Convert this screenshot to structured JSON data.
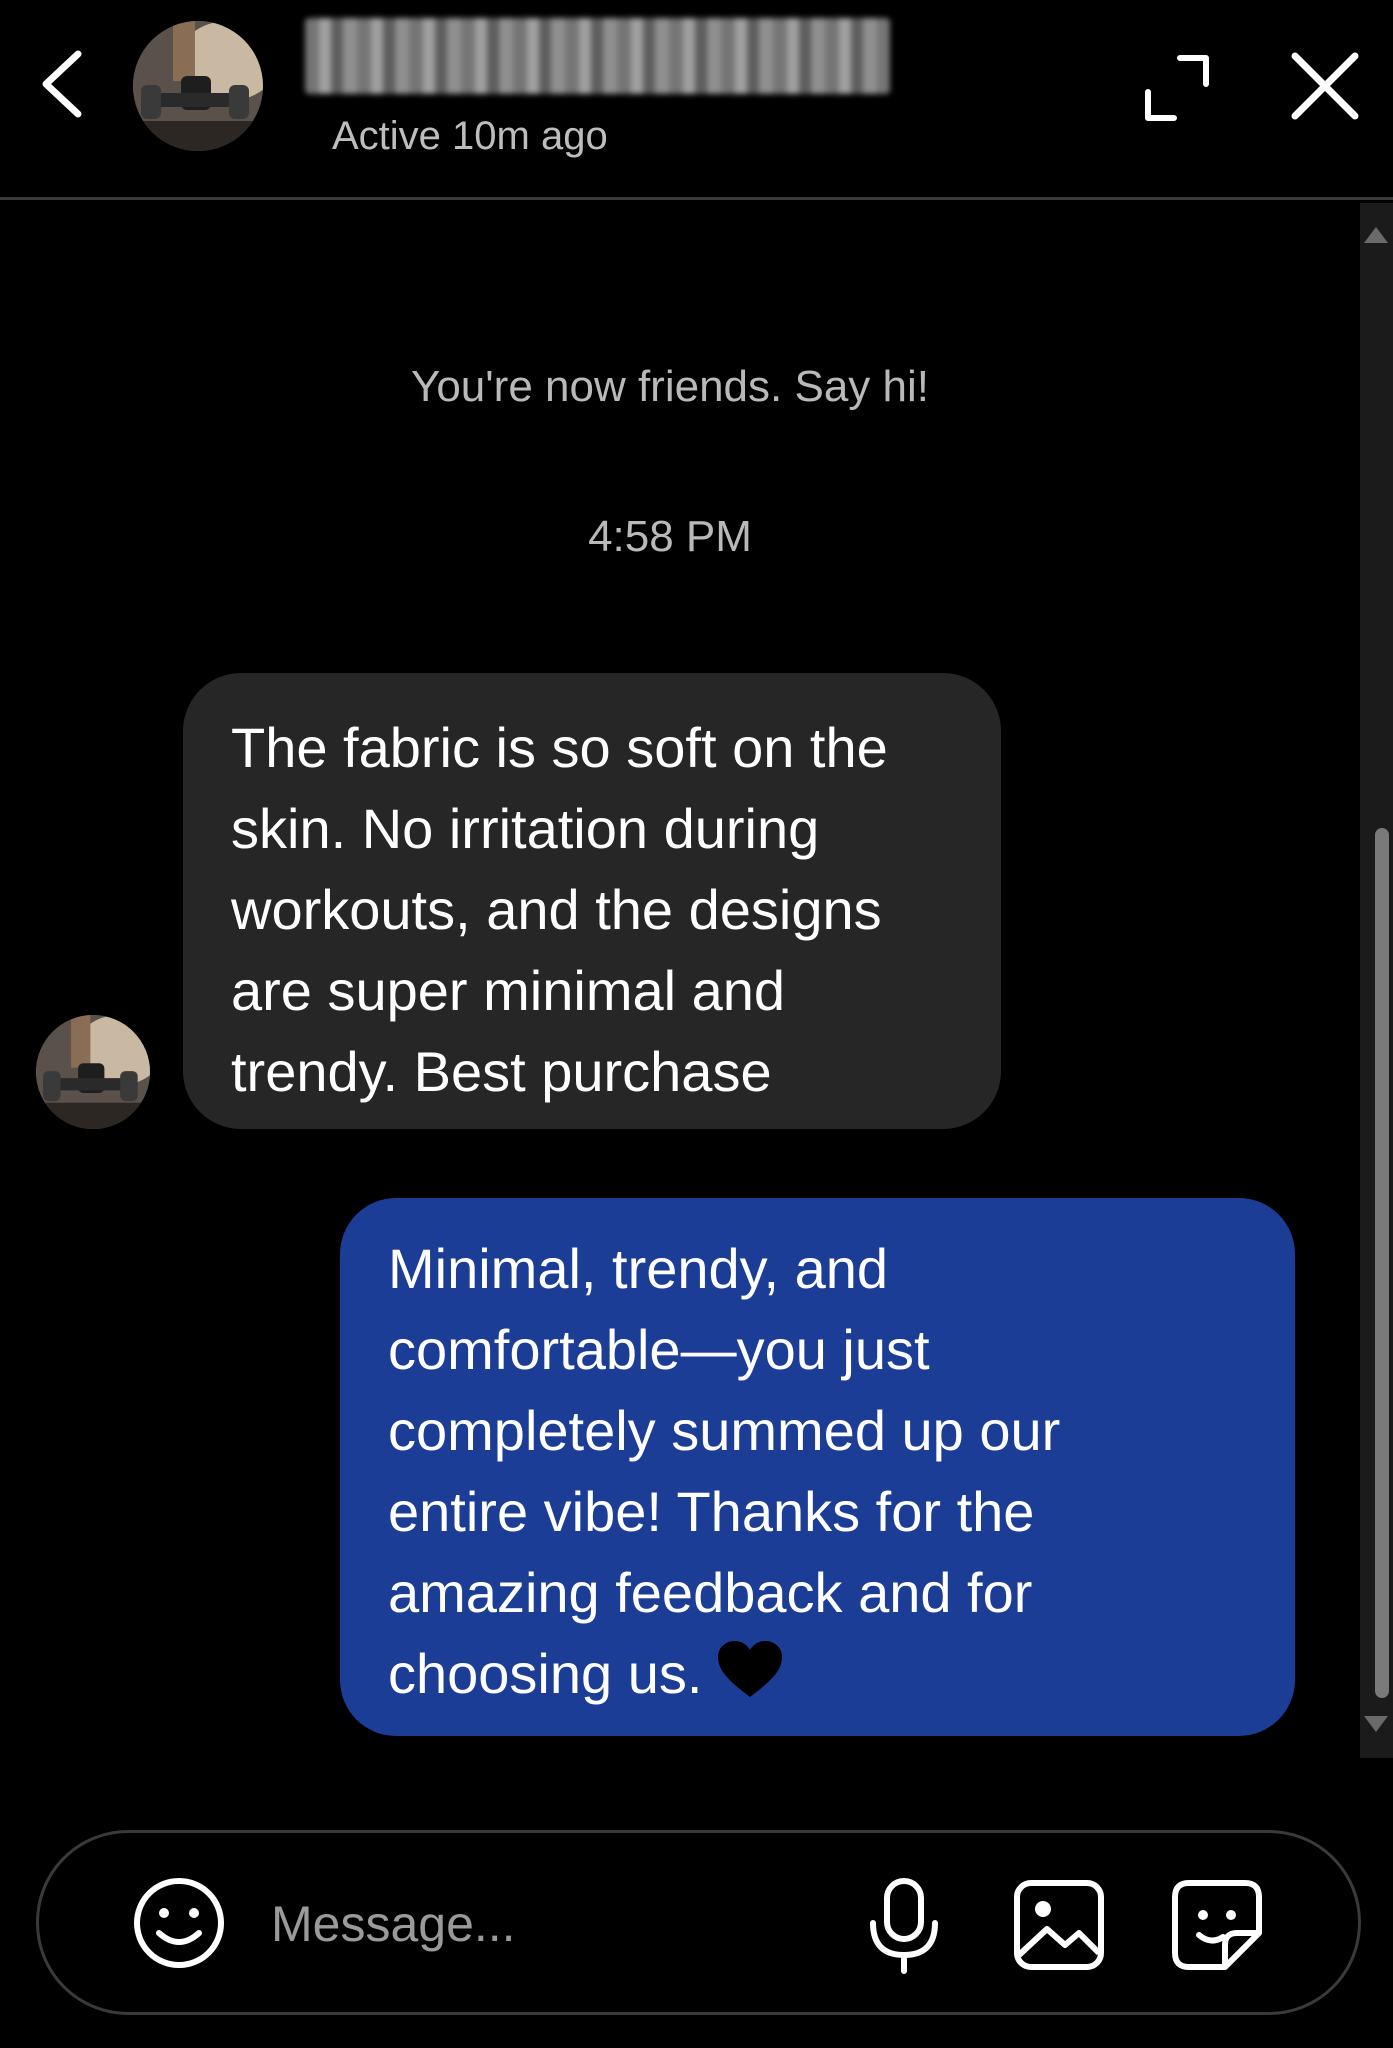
{
  "header": {
    "active_status": "Active 10m ago"
  },
  "conversation": {
    "system_message": "You're now friends. Say hi!",
    "timestamp": "4:58 PM",
    "incoming_message": "The fabric is so soft on the\nskin. No irritation during\nworkouts, and the designs\nare super minimal and\ntrendy. Best purchase",
    "outgoing_message": "Minimal, trendy, and\ncomfortable—you just\ncompletely summed up our\nentire vibe! Thanks for the\namazing feedback and for\nchoosing us."
  },
  "composer": {
    "placeholder": "Message..."
  },
  "colors": {
    "background": "#000000",
    "incoming_bubble": "#262626",
    "outgoing_bubble": "#1c3d96",
    "secondary_text": "#b9b9b9"
  },
  "icons": {
    "back": "chevron-left-icon",
    "expand": "expand-icon",
    "close": "close-icon",
    "emoji": "smiley-icon",
    "mic": "microphone-icon",
    "image": "image-icon",
    "sticker": "sticker-icon",
    "heart": "heart-icon"
  }
}
